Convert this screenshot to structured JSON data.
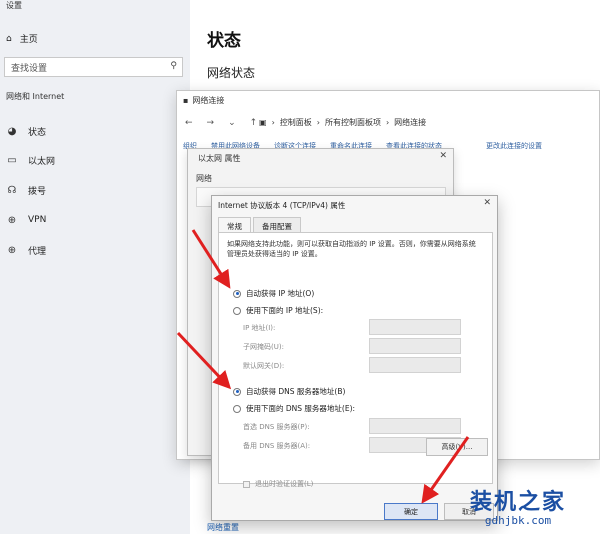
{
  "app": {
    "title": "设置"
  },
  "sidebar": {
    "home_label": "主页",
    "search_placeholder": "查找设置",
    "section_label": "网络和 Internet",
    "items": [
      {
        "label": "状态",
        "icon": "globe-icon"
      },
      {
        "label": "以太网",
        "icon": "ethernet-icon"
      },
      {
        "label": "拨号",
        "icon": "dialup-icon"
      },
      {
        "label": "VPN",
        "icon": "vpn-icon"
      },
      {
        "label": "代理",
        "icon": "proxy-globe-icon"
      }
    ]
  },
  "main": {
    "title": "状态",
    "subtitle": "网络状态",
    "footer_link": "网络重置"
  },
  "explorer": {
    "title": "网络连接",
    "breadcrumb": [
      "控制面板",
      "所有控制面板项",
      "网络连接"
    ],
    "commands": [
      "组织",
      "禁用此网络设备",
      "诊断这个连接",
      "重命名此连接",
      "查看此连接的状态",
      "更改此连接的设置"
    ]
  },
  "eth_dialog": {
    "title": "以太网 属性",
    "tab": "网络"
  },
  "ipv4_dialog": {
    "title": "Internet 协议版本 4 (TCP/IPv4) 属性",
    "tabs": [
      "常规",
      "备用配置"
    ],
    "description": "如果网络支持此功能，则可以获取自动指派的 IP 设置。否则，你需要从网络系统管理员处获得适当的 IP 设置。",
    "auto_ip": "自动获得 IP 地址(O)",
    "manual_ip": "使用下面的 IP 地址(S):",
    "ip_label": "IP 地址(I):",
    "mask_label": "子网掩码(U):",
    "gateway_label": "默认网关(D):",
    "auto_dns": "自动获得 DNS 服务器地址(B)",
    "manual_dns": "使用下面的 DNS 服务器地址(E):",
    "dns1_label": "首选 DNS 服务器(P):",
    "dns2_label": "备用 DNS 服务器(A):",
    "validate_label": "退出时验证设置(L)",
    "advanced_label": "高级(V)...",
    "ok_label": "确定",
    "cancel_label": "取消"
  },
  "watermark": {
    "name": "装机之家",
    "url": "gdhjbk.com"
  },
  "colors": {
    "arrow": "#e02020",
    "link": "#1a5fb4",
    "accent": "#1f5fbf",
    "watermark": "#1b4fa3"
  }
}
